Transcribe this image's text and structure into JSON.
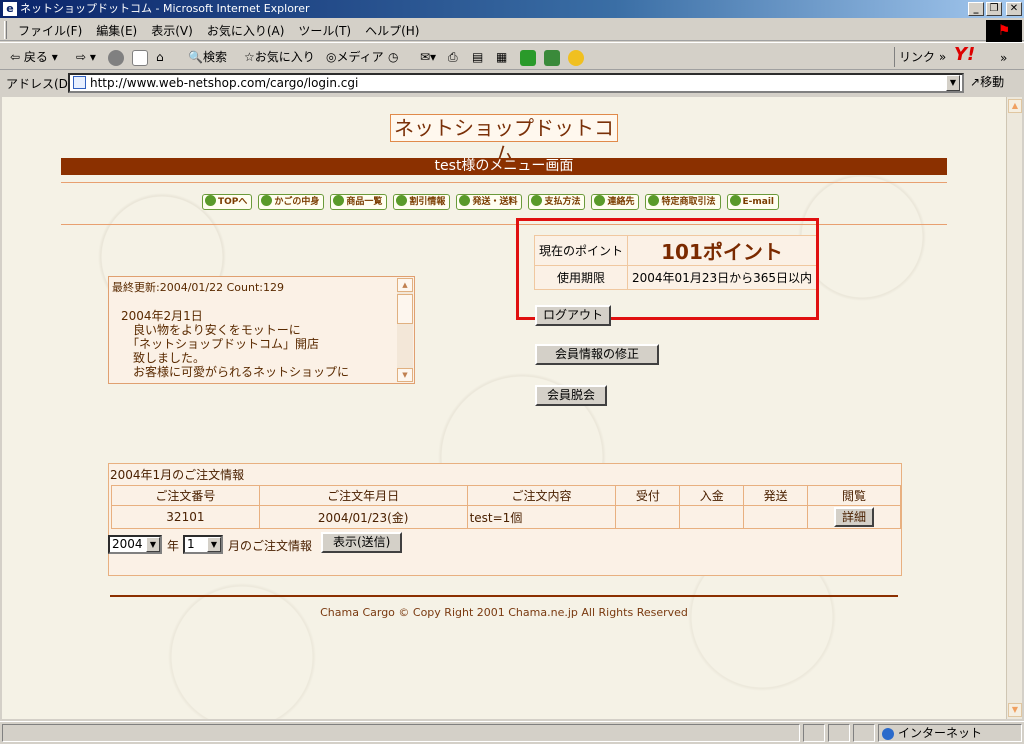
{
  "window": {
    "title": "ネットショップドットコム - Microsoft Internet Explorer"
  },
  "menubar": [
    "ファイル(F)",
    "編集(E)",
    "表示(V)",
    "お気に入り(A)",
    "ツール(T)",
    "ヘルプ(H)"
  ],
  "toolbar": {
    "back": "戻る",
    "search": "検索",
    "favorites": "お気に入り",
    "media": "メディア",
    "links": "リンク"
  },
  "address": {
    "label": "アドレス(D)",
    "url": "http://www.web-netshop.com/cargo/login.cgi",
    "go": "移動"
  },
  "page": {
    "site_title": "ネットショップドットコム",
    "menu_title": "test様のメニュー画面",
    "nav": [
      "TOPへ",
      "かごの中身",
      "商品一覧",
      "割引情報",
      "発送・送料",
      "支払方法",
      "連絡先",
      "特定商取引法",
      "E-mail"
    ],
    "points": {
      "current_label": "現在のポイント",
      "current_value": "101ポイント",
      "expiry_label": "使用期限",
      "expiry_value": "2004年01月23日から365日以内"
    },
    "buttons": {
      "logout": "ログアウト",
      "edit_member": "会員情報の修正",
      "withdraw": "会員脱会"
    },
    "news": {
      "updated": "最終更新:2004/01/22 Count:129",
      "body": "2004年2月1日\n　良い物をより安くをモットーに\n　「ネットショップドットコム」開店\n　致しました。\n　お客様に可愛がられるネットショップに"
    },
    "orders": {
      "caption": "2004年1月のご注文情報",
      "headers": [
        "ご注文番号",
        "ご注文年月日",
        "ご注文内容",
        "受付",
        "入金",
        "発送",
        "閲覧"
      ],
      "rows": [
        {
          "no": "32101",
          "date": "2004/01/23(金)",
          "content": "test=1個",
          "accepted": "",
          "paid": "",
          "shipped": "",
          "view": "詳細"
        }
      ],
      "year_value": "2004",
      "year_unit": "年",
      "month_value": "1",
      "month_suffix": "月のご注文情報",
      "submit": "表示(送信)"
    },
    "footer": "Chama Cargo © Copy Right 2001 Chama.ne.jp All Rights Reserved"
  },
  "status": {
    "zone": "インターネット"
  }
}
